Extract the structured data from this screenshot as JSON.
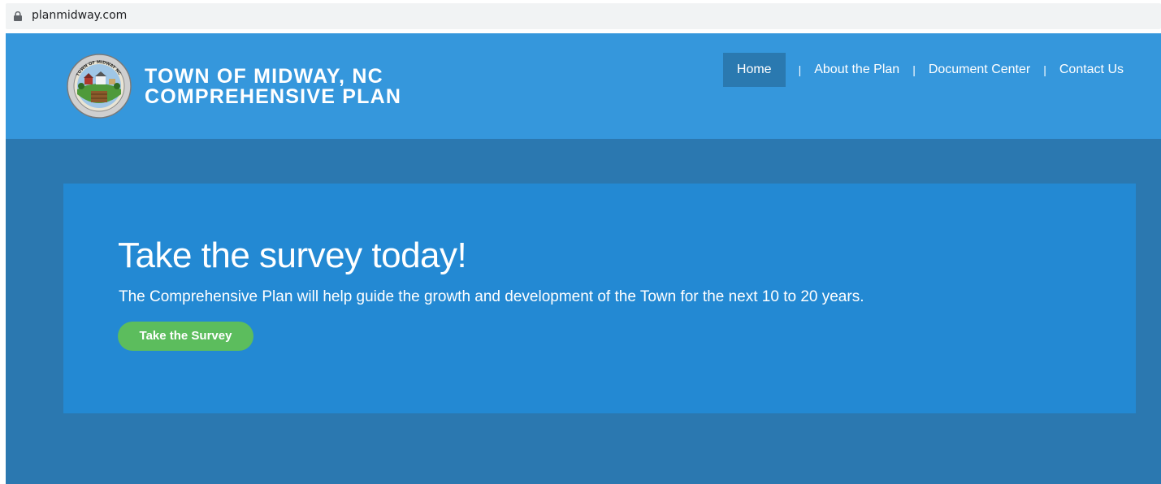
{
  "browser": {
    "url": "planmidway.com",
    "lock_icon": "lock-icon"
  },
  "header": {
    "logo_icon": "town-seal-logo",
    "logo_text": "TOWN OF MIDWAY NC · GATEWAY TO DAVIDSON COUNTY",
    "title_line1": "TOWN OF MIDWAY, NC",
    "title_line2": "COMPREHENSIVE PLAN",
    "background_color": "#3597dc"
  },
  "nav": {
    "items": [
      {
        "label": "Home",
        "active": true
      },
      {
        "label": "About the Plan",
        "active": false
      },
      {
        "label": "Document Center",
        "active": false
      },
      {
        "label": "Contact Us",
        "active": false
      }
    ],
    "separator": "|",
    "active_color": "#2a79b0"
  },
  "hero": {
    "title": "Take the survey today!",
    "subtitle": "The Comprehensive Plan will help guide the growth and development of the Town for the next 10 to 20 years.",
    "button_label": "Take the Survey",
    "button_color": "#5cbd5d",
    "panel_color": "#2389d3",
    "page_background": "#2b78b0"
  }
}
